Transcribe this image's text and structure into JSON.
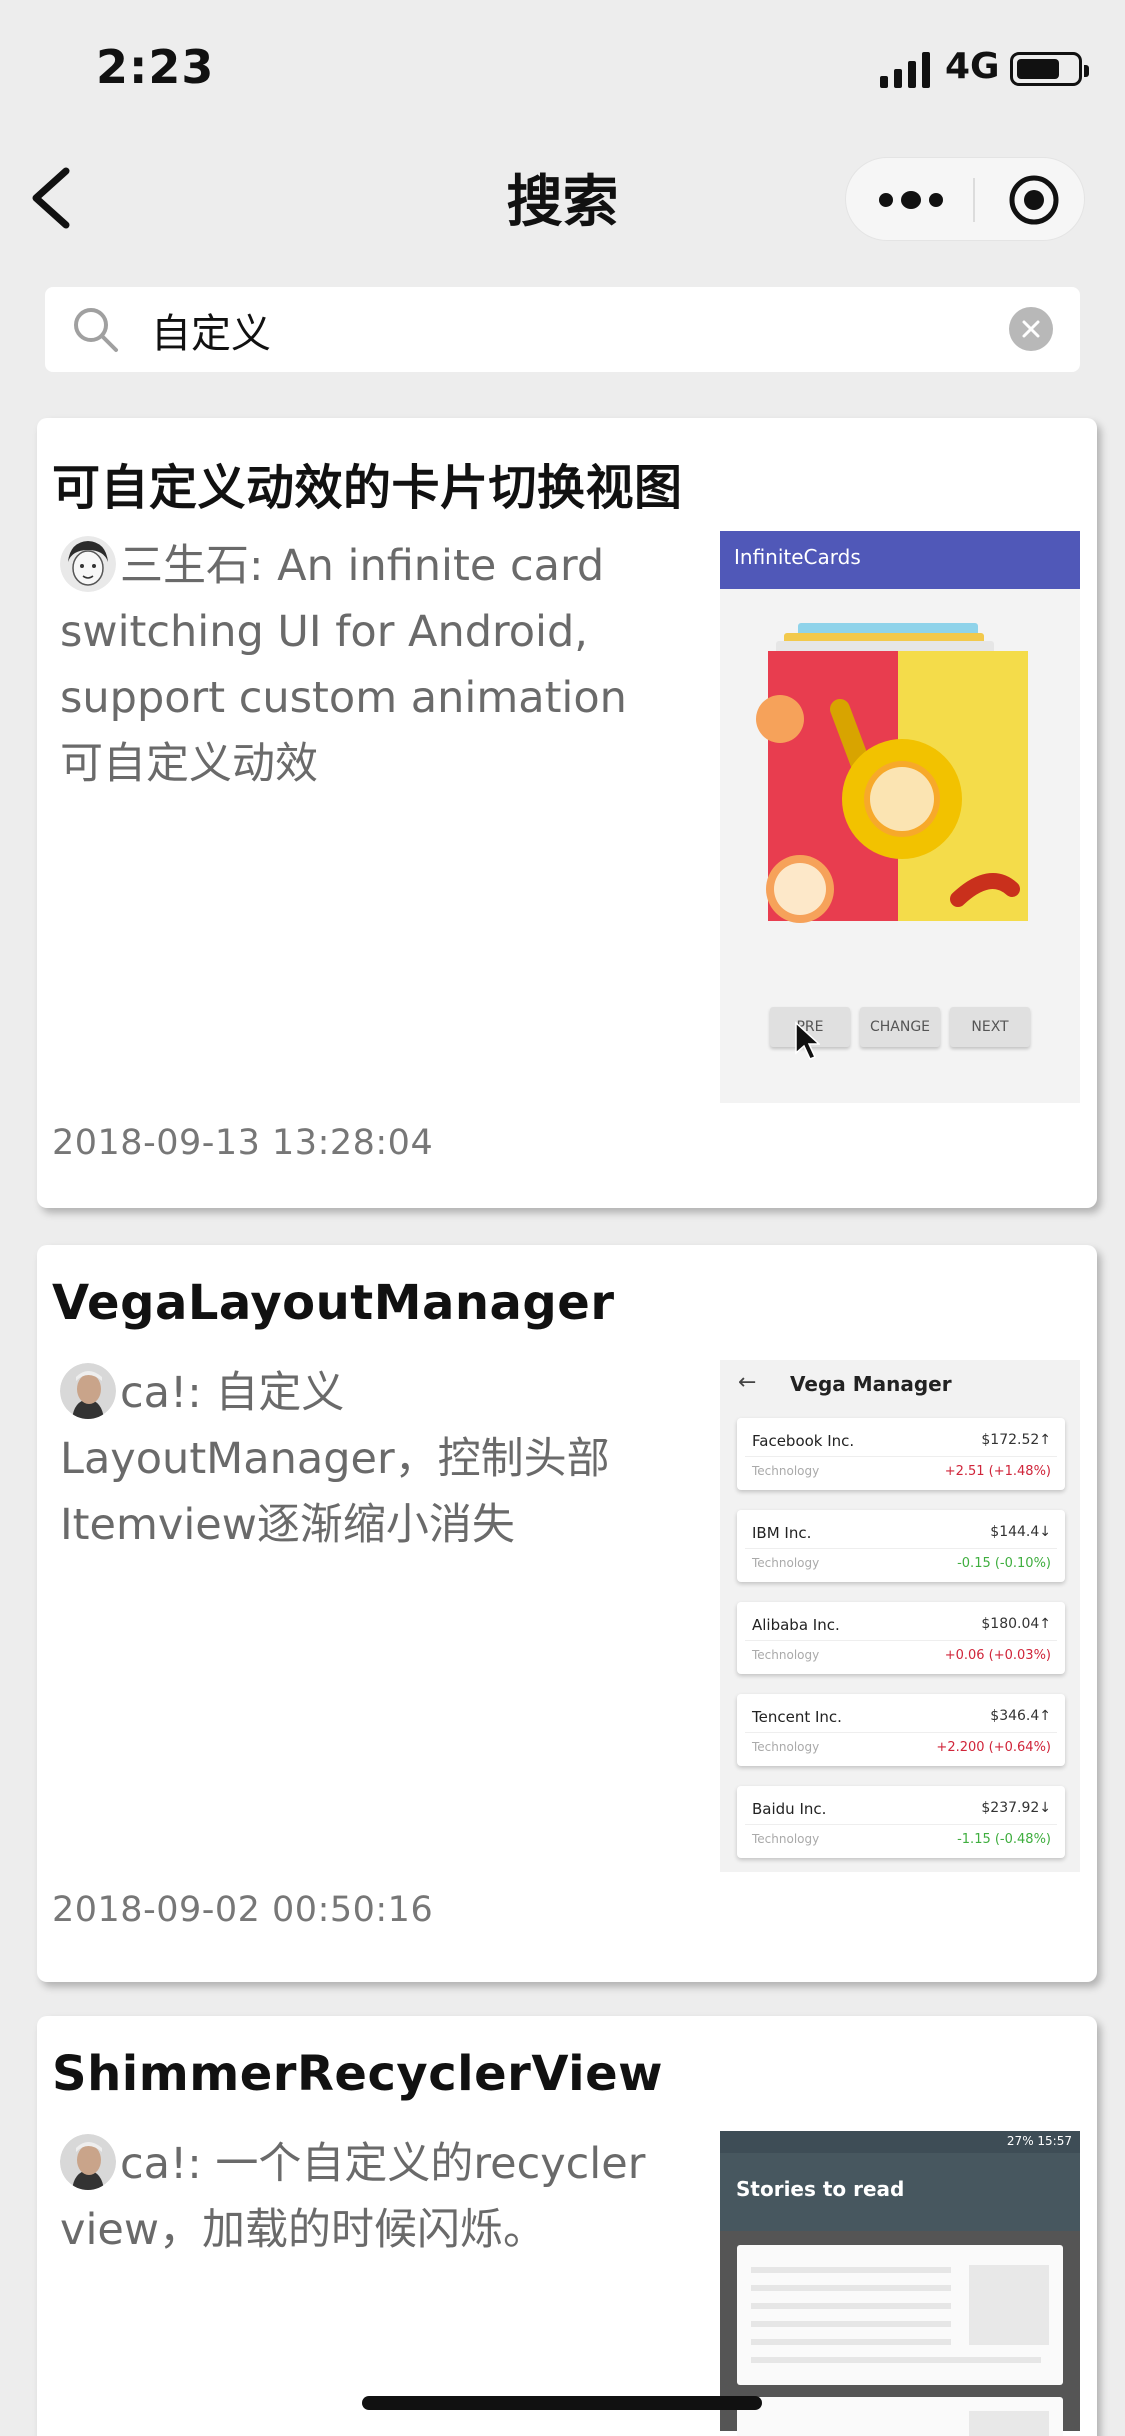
{
  "status_bar": {
    "time": "2:23",
    "network": "4G",
    "battery_level": 0.72
  },
  "nav": {
    "title": "搜索",
    "back_icon": "chevron-left-icon",
    "more_icon": "more-dots-icon",
    "close_icon": "target-circle-icon"
  },
  "search": {
    "value": "自定义",
    "placeholder": ""
  },
  "results": [
    {
      "title": "可自定义动效的卡片切换视图",
      "author": "三生石",
      "desc": ": An infinite card switching UI for Android, support custom animation 可自定义动效",
      "date": "2018-09-13 13:28:04",
      "thumb": {
        "app_title": "InfiniteCards",
        "buttons": [
          "PRE",
          "CHANGE",
          "NEXT"
        ]
      }
    },
    {
      "title": "VegaLayoutManager",
      "author": "ca!",
      "desc": ": 自定义LayoutManager，控制头部Itemview逐渐缩小消失",
      "date": "2018-09-02 00:50:16",
      "thumb": {
        "app_title": "Vega Manager",
        "stocks": [
          {
            "name": "Facebook Inc.",
            "price": "$172.52↑",
            "sector": "Technology",
            "change": "+2.51 (+1.48%)",
            "color": "#d0253a"
          },
          {
            "name": "IBM Inc.",
            "price": "$144.4↓",
            "sector": "Technology",
            "change": "-0.15 (-0.10%)",
            "color": "#3fae3f"
          },
          {
            "name": "Alibaba Inc.",
            "price": "$180.04↑",
            "sector": "Technology",
            "change": "+0.06 (+0.03%)",
            "color": "#d0253a"
          },
          {
            "name": "Tencent Inc.",
            "price": "$346.4↑",
            "sector": "Technology",
            "change": "+2.200 (+0.64%)",
            "color": "#d0253a"
          },
          {
            "name": "Baidu Inc.",
            "price": "$237.92↓",
            "sector": "Technology",
            "change": "-1.15 (-0.48%)",
            "color": "#3fae3f"
          }
        ]
      }
    },
    {
      "title": "ShimmerRecyclerView",
      "author": "ca!",
      "desc": ": 一个自定义的recycler view，加载的时候闪烁。",
      "thumb": {
        "app_title": "Stories to read",
        "status_time": "27% 15:57"
      }
    }
  ]
}
